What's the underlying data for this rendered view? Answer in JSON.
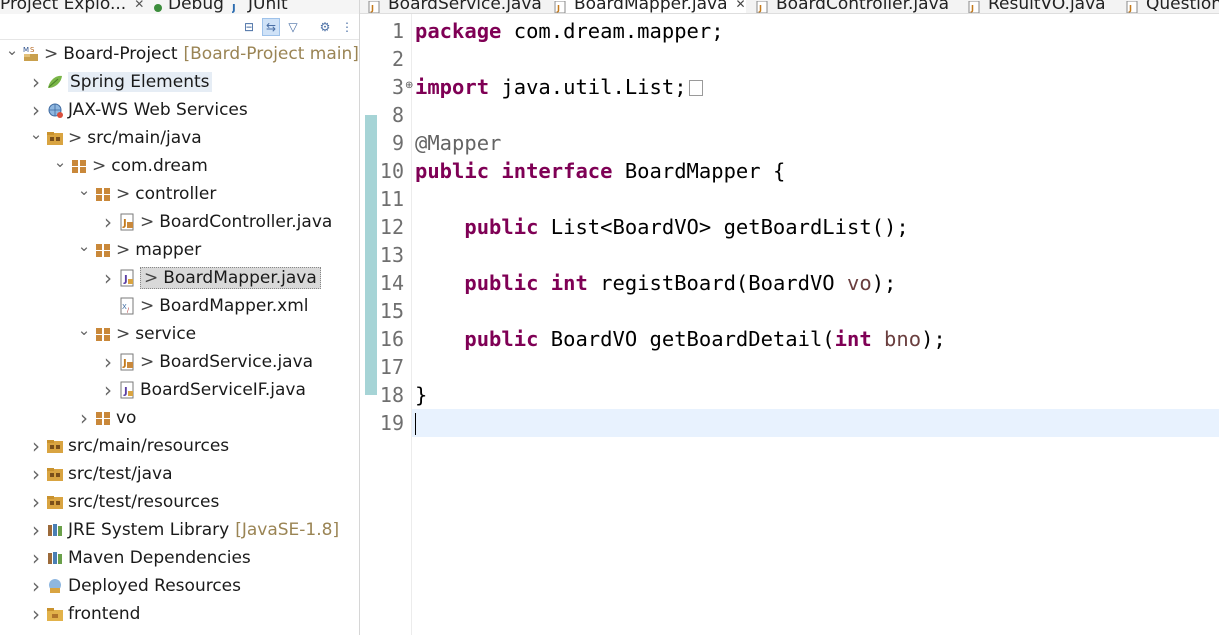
{
  "explorer": {
    "tabs": [
      {
        "label": "Project Explo...",
        "close": "✕"
      },
      {
        "label": "Debug",
        "icon": "debug-icon"
      },
      {
        "label": "JUnit",
        "icon": "junit-icon"
      }
    ],
    "toolbar": [
      "collapse-all-icon",
      "link-with-editor-icon",
      "filter-icon",
      "view-menu-icon",
      "more-icon"
    ],
    "tree": [
      {
        "level": 0,
        "twisty": "down",
        "icon": "maven-project-icon",
        "decor": ">",
        "label": "Board-Project",
        "extra": "[Board-Project main]"
      },
      {
        "level": 1,
        "twisty": "right",
        "icon": "spring-leaf-icon",
        "label": "Spring Elements",
        "highlight": true
      },
      {
        "level": 1,
        "twisty": "right",
        "icon": "web-services-icon",
        "label": "JAX-WS Web Services"
      },
      {
        "level": 1,
        "twisty": "down",
        "icon": "source-folder-icon",
        "decor": ">",
        "label": "src/main/java"
      },
      {
        "level": 2,
        "twisty": "down",
        "icon": "package-icon",
        "decor": ">",
        "label": "com.dream"
      },
      {
        "level": 3,
        "twisty": "down",
        "icon": "package-icon",
        "decor": ">",
        "label": "controller"
      },
      {
        "level": 4,
        "twisty": "right",
        "icon": "java-file-icon",
        "decor": ">",
        "label": "BoardController.java"
      },
      {
        "level": 3,
        "twisty": "down",
        "icon": "package-icon",
        "decor": ">",
        "label": "mapper"
      },
      {
        "level": 4,
        "twisty": "right",
        "icon": "java-interface-file-icon",
        "decor": ">",
        "label": "BoardMapper.java",
        "selected": true
      },
      {
        "level": 4,
        "twisty": "none",
        "icon": "xml-file-icon",
        "decor": ">",
        "label": "BoardMapper.xml"
      },
      {
        "level": 3,
        "twisty": "down",
        "icon": "package-icon",
        "decor": ">",
        "label": "service"
      },
      {
        "level": 4,
        "twisty": "right",
        "icon": "java-file-icon",
        "decor": ">",
        "label": "BoardService.java"
      },
      {
        "level": 4,
        "twisty": "right",
        "icon": "java-interface-file-icon",
        "label": "BoardServiceIF.java"
      },
      {
        "level": 3,
        "twisty": "right",
        "icon": "package-icon",
        "label": "vo"
      },
      {
        "level": 1,
        "twisty": "right",
        "icon": "source-folder-icon",
        "label": "src/main/resources"
      },
      {
        "level": 1,
        "twisty": "right",
        "icon": "source-folder-icon",
        "label": "src/test/java"
      },
      {
        "level": 1,
        "twisty": "right",
        "icon": "source-folder-icon",
        "label": "src/test/resources"
      },
      {
        "level": 1,
        "twisty": "right",
        "icon": "library-icon",
        "label": "JRE System Library",
        "extra": "[JavaSE-1.8]"
      },
      {
        "level": 1,
        "twisty": "right",
        "icon": "library-icon",
        "label": "Maven Dependencies"
      },
      {
        "level": 1,
        "twisty": "right",
        "icon": "deployed-resources-icon",
        "label": "Deployed Resources"
      },
      {
        "level": 1,
        "twisty": "right",
        "icon": "folder-icon",
        "label": "frontend"
      }
    ]
  },
  "editor": {
    "tabs": [
      {
        "label": "BoardService.java"
      },
      {
        "label": "BoardMapper.java",
        "active": true,
        "close": "✕"
      },
      {
        "label": "BoardController.java"
      },
      {
        "label": "ResultVO.java"
      },
      {
        "label": "Question"
      }
    ],
    "lines": [
      {
        "n": "1",
        "parts": [
          [
            "kw",
            "package"
          ],
          [
            "t",
            " com.dream.mapper;"
          ]
        ]
      },
      {
        "n": "2",
        "parts": []
      },
      {
        "n": "3",
        "fold": "⊕",
        "parts": [
          [
            "kw",
            "import"
          ],
          [
            "t",
            " java.util.List;"
          ]
        ],
        "folded": true
      },
      {
        "n": "8",
        "parts": []
      },
      {
        "n": "9",
        "parts": [
          [
            "ann",
            "@Mapper"
          ]
        ],
        "changed": true
      },
      {
        "n": "10",
        "parts": [
          [
            "kw",
            "public"
          ],
          [
            "t",
            " "
          ],
          [
            "kw",
            "interface"
          ],
          [
            "t",
            " BoardMapper {"
          ]
        ],
        "changed": true
      },
      {
        "n": "11",
        "parts": [],
        "changed": true
      },
      {
        "n": "12",
        "parts": [
          [
            "t",
            "    "
          ],
          [
            "kw",
            "public"
          ],
          [
            "t",
            " List<BoardVO> getBoardList();"
          ]
        ],
        "changed": true
      },
      {
        "n": "13",
        "parts": [],
        "changed": true
      },
      {
        "n": "14",
        "parts": [
          [
            "t",
            "    "
          ],
          [
            "kw",
            "public"
          ],
          [
            "t",
            " "
          ],
          [
            "kw",
            "int"
          ],
          [
            "t",
            " registBoard(BoardVO "
          ],
          [
            "par",
            "vo"
          ],
          [
            "t",
            ");"
          ]
        ],
        "changed": true
      },
      {
        "n": "15",
        "parts": [],
        "changed": true
      },
      {
        "n": "16",
        "parts": [
          [
            "t",
            "    "
          ],
          [
            "kw",
            "public"
          ],
          [
            "t",
            " BoardVO getBoardDetail("
          ],
          [
            "kw",
            "int"
          ],
          [
            "t",
            " "
          ],
          [
            "par",
            "bno"
          ],
          [
            "t",
            ");"
          ]
        ],
        "changed": true
      },
      {
        "n": "17",
        "parts": [],
        "changed": true
      },
      {
        "n": "18",
        "parts": [
          [
            "t",
            "}"
          ]
        ],
        "changed": true
      },
      {
        "n": "19",
        "parts": [],
        "current": true
      }
    ]
  }
}
